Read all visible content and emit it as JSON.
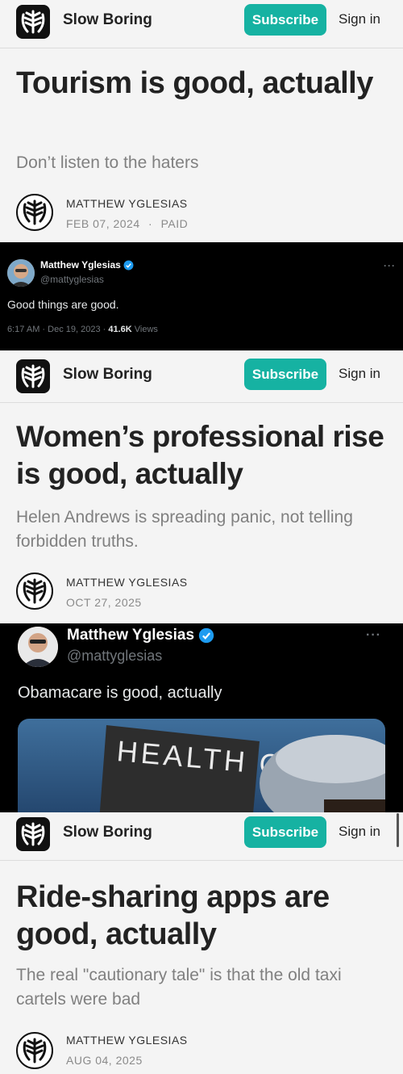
{
  "site": {
    "name": "Slow Boring",
    "subscribe_label": "Subscribe",
    "signin_label": "Sign in",
    "accent": "#16b2a2"
  },
  "posts": [
    {
      "title": "Tourism is good, actually",
      "subtitle": "Don’t listen to the haters",
      "author": "MATTHEW YGLESIAS",
      "date": "FEB 07, 2024",
      "sep": "·",
      "badge": "PAID"
    },
    {
      "title": "Women’s professional rise is good, actually",
      "subtitle": "Helen Andrews is spreading panic, not telling forbidden truths.",
      "author": "MATTHEW YGLESIAS",
      "date": "OCT 27, 2025"
    },
    {
      "title": "Ride-sharing apps are good, actually",
      "subtitle": "The real \"cautionary tale\" is that the old taxi cartels were bad",
      "author": "MATTHEW YGLESIAS",
      "date": "AUG 04, 2025"
    }
  ],
  "tweets": [
    {
      "name": "Matthew Yglesias",
      "handle": "@mattyglesias",
      "text": "Good things are good.",
      "time": "6:17 AM · Dec 19, 2023 · ",
      "views_count": "41.6K",
      "views_label": " Views",
      "more": "···"
    },
    {
      "name": "Matthew Yglesias",
      "handle": "@mattyglesias",
      "text": "Obamacare is good, actually",
      "more": "···",
      "image_sign_text": "HEALTH CARE"
    }
  ]
}
